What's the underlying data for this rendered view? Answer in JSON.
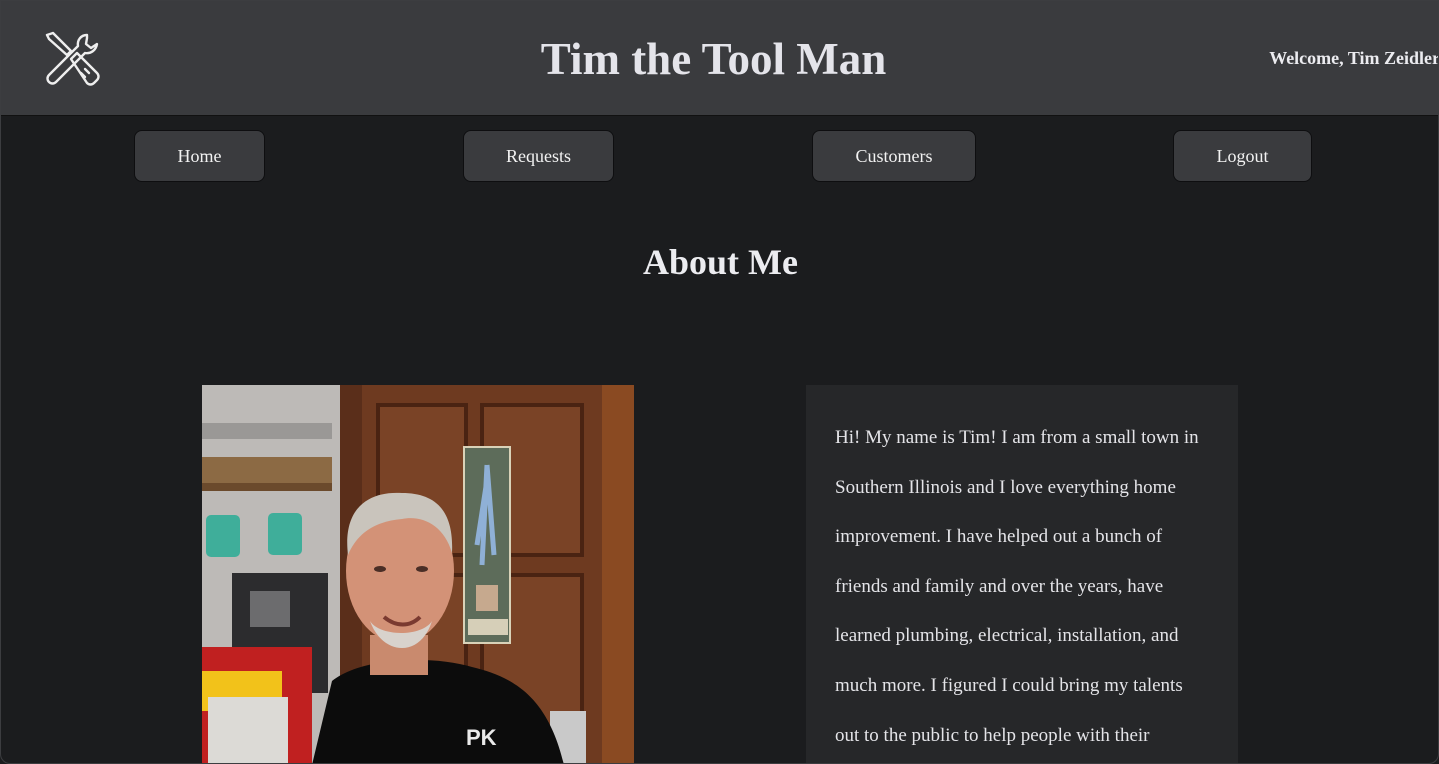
{
  "header": {
    "title": "Tim the Tool Man",
    "welcome": "Welcome, Tim Zeidler",
    "logo_icon": "tools-icon"
  },
  "nav": {
    "items": [
      {
        "label": "Home"
      },
      {
        "label": "Requests"
      },
      {
        "label": "Customers"
      },
      {
        "label": "Logout"
      }
    ]
  },
  "about": {
    "title": "About Me",
    "bio": "Hi! My name is Tim! I am from a small town in Southern Illinois and I love everything home improvement. I have helped out a bunch of friends and family and over the years, have learned plumbing, electrical, installation, and much more. I figured I could bring my talents out to the public to help people with their",
    "photo_icon": "profile-photo"
  },
  "colors": {
    "background": "#1b1c1e",
    "header": "#3a3b3e",
    "card": "#262729"
  }
}
